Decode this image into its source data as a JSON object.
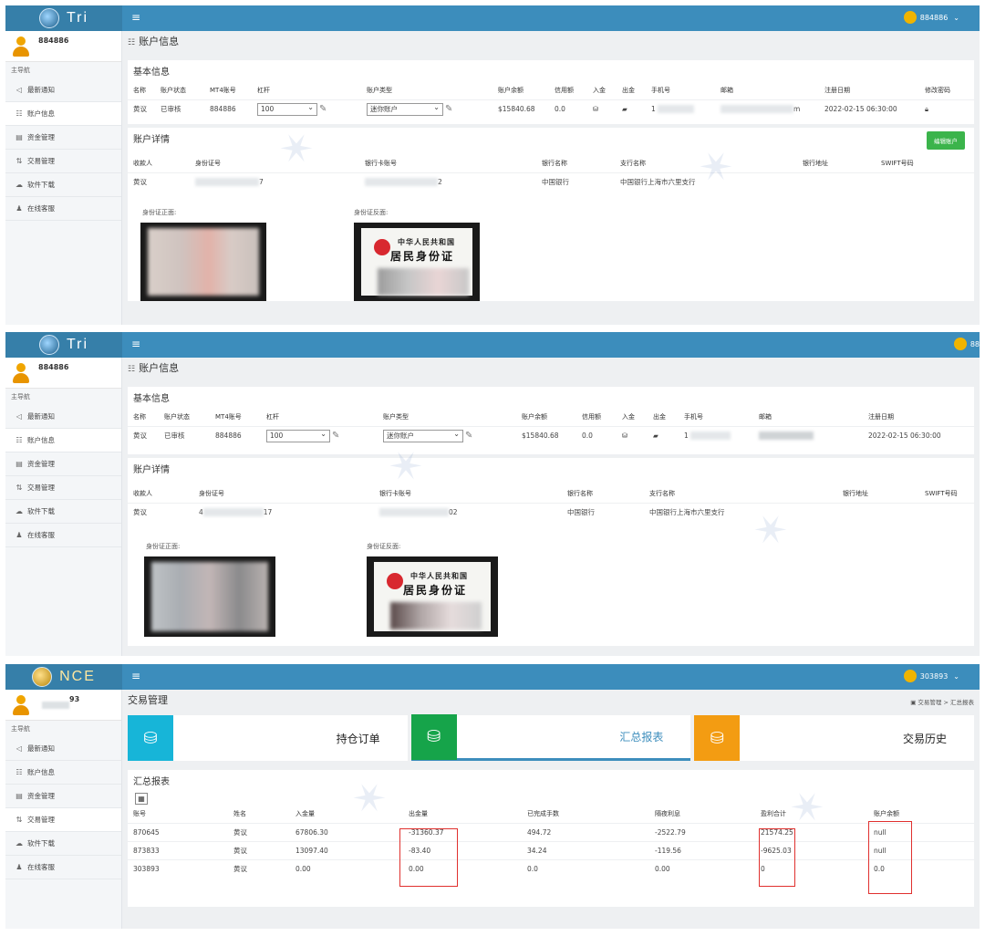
{
  "colors": {
    "header": "#3c8dbc",
    "logo_bg": "#367fa9",
    "green": "#3bb44b",
    "red_annot": "#e0302e",
    "tile_cyan": "#17b5d8",
    "tile_green": "#16a44a",
    "tile_orange": "#f39c12"
  },
  "panel1": {
    "logo": "Tri",
    "user_top": "884886",
    "username": "884886",
    "nav_header": "主导航",
    "nav": [
      "最新通知",
      "账户信息",
      "资金管理",
      "交易管理",
      "软件下载",
      "在线客服"
    ],
    "page_title": "账户信息",
    "basic_title": "基本信息",
    "basic_headers": [
      "名称",
      "账户状态",
      "MT4账号",
      "杠杆",
      "账户类型",
      "账户余额",
      "信用额",
      "入金",
      "出金",
      "手机号",
      "邮箱",
      "注册日期",
      "修改密码"
    ],
    "basic_row": {
      "name": "黄议",
      "status": "已审核",
      "mt4": "884886",
      "leverage": "100",
      "type": "迷你账户",
      "balance": "$15840.68",
      "credit": "0.0",
      "phone_partial": "1",
      "email_partial": "m",
      "reg_date": "2022-02-15 06:30:00"
    },
    "detail_title": "账户详情",
    "edit_button": "编辑账户",
    "detail_headers": [
      "收款人",
      "身份证号",
      "银行卡账号",
      "银行名称",
      "支行名称",
      "银行地址",
      "SWIFT号码"
    ],
    "detail_row": {
      "payee": "黄议",
      "id_partial": "7",
      "card_partial": "2",
      "bank": "中国银行",
      "branch": "中国银行上海市六里支行"
    },
    "id_front_label": "身份证正面:",
    "id_back_label": "身份证反面:",
    "id_back_t1": "中华人民共和国",
    "id_back_t2": "居民身份证"
  },
  "panel2": {
    "logo": "Tri",
    "user_top": "88",
    "username": "884886",
    "nav_header": "主导航",
    "nav": [
      "最新通知",
      "账户信息",
      "资金管理",
      "交易管理",
      "软件下载",
      "在线客服"
    ],
    "page_title": "账户信息",
    "basic_title": "基本信息",
    "basic_headers": [
      "名称",
      "账户状态",
      "MT4账号",
      "杠杆",
      "账户类型",
      "账户余额",
      "信用额",
      "入金",
      "出金",
      "手机号",
      "邮箱",
      "注册日期"
    ],
    "basic_row": {
      "name": "黄议",
      "status": "已审核",
      "mt4": "884886",
      "leverage": "100",
      "type": "迷你账户",
      "balance": "$15840.68",
      "credit": "0.0",
      "phone_partial": "1",
      "reg_date": "2022-02-15 06:30:00"
    },
    "detail_title": "账户详情",
    "detail_headers": [
      "收款人",
      "身份证号",
      "银行卡账号",
      "银行名称",
      "支行名称",
      "银行地址",
      "SWIFT号码"
    ],
    "detail_row": {
      "payee": "黄议",
      "id_partial": "4",
      "id_tail": "17",
      "card_partial": "",
      "card_tail": "02",
      "bank": "中国银行",
      "branch": "中国银行上海市六里支行"
    },
    "id_front_label": "身份证正面:",
    "id_back_label": "身份证反面:",
    "id_back_t1": "中华人民共和国",
    "id_back_t2": "居民身份证"
  },
  "panel3": {
    "logo": "NCE",
    "user_top": "303893",
    "username_tail": "93",
    "nav_header": "主导航",
    "nav": [
      "最新通知",
      "账户信息",
      "资金管理",
      "交易管理",
      "软件下载",
      "在线客服"
    ],
    "page_title": "交易管理",
    "breadcrumb": "交易管理 > 汇总报表",
    "tiles": [
      "持仓订单",
      "汇总报表",
      "交易历史"
    ],
    "report_title": "汇总报表",
    "headers": [
      "账号",
      "姓名",
      "入金量",
      "出金量",
      "已完成手数",
      "隔夜利息",
      "盈利合计",
      "账户余额"
    ],
    "rows": [
      [
        "870645",
        "黄议",
        "67806.30",
        "-31360.37",
        "494.72",
        "-2522.79",
        "21574.25",
        "null"
      ],
      [
        "873833",
        "黄议",
        "13097.40",
        "-83.40",
        "34.24",
        "-119.56",
        "-9625.03",
        "null"
      ],
      [
        "303893",
        "黄议",
        "0.00",
        "0.00",
        "0.0",
        "0.00",
        "0",
        "0.0"
      ]
    ]
  }
}
